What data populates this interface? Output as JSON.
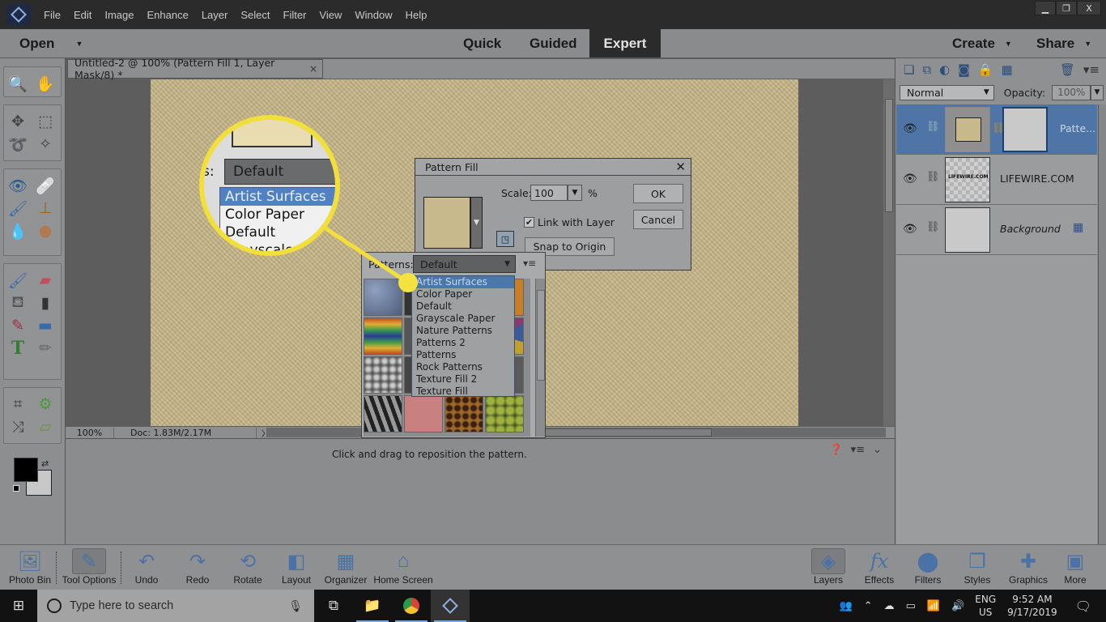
{
  "app": {
    "menu": [
      "File",
      "Edit",
      "Image",
      "Enhance",
      "Layer",
      "Select",
      "Filter",
      "View",
      "Window",
      "Help"
    ],
    "window_controls": {
      "minimize": "▁",
      "restore": "❐",
      "close": "X"
    }
  },
  "modebar": {
    "open_label": "Open",
    "modes": [
      {
        "label": "Quick",
        "active": false
      },
      {
        "label": "Guided",
        "active": false
      },
      {
        "label": "Expert",
        "active": true
      }
    ],
    "create_label": "Create",
    "share_label": "Share"
  },
  "document": {
    "tab_title": "Untitled-2 @ 100% (Pattern Fill 1, Layer Mask/8) *",
    "tab_close": "×",
    "zoom": "100%",
    "doc_size": "Doc: 1.83M/2.17M",
    "hint": "Click and drag to reposition the pattern."
  },
  "tools": [
    {
      "name": "zoom-tool",
      "glyph": "🔍"
    },
    {
      "name": "hand-tool",
      "glyph": "✋"
    },
    {
      "name": "move-tool",
      "glyph": "✥"
    },
    {
      "name": "marquee-tool",
      "glyph": "⬚"
    },
    {
      "name": "lasso-tool",
      "glyph": "➰"
    },
    {
      "name": "quick-selection-tool",
      "glyph": "✧"
    },
    {
      "name": "red-eye-tool",
      "glyph": "👁"
    },
    {
      "name": "spot-healing-tool",
      "glyph": "🩹"
    },
    {
      "name": "smart-brush-tool",
      "glyph": "🖌"
    },
    {
      "name": "clone-stamp-tool",
      "glyph": "⊥"
    },
    {
      "name": "blur-tool",
      "glyph": "💧"
    },
    {
      "name": "sponge-tool",
      "glyph": "●"
    },
    {
      "name": "brush-tool",
      "glyph": "🖌"
    },
    {
      "name": "eraser-tool",
      "glyph": "▰"
    },
    {
      "name": "paint-bucket-tool",
      "glyph": "⛾"
    },
    {
      "name": "gradient-tool",
      "glyph": "▮"
    },
    {
      "name": "eyedropper-tool",
      "glyph": "✎"
    },
    {
      "name": "shape-tool",
      "glyph": "▬"
    },
    {
      "name": "type-tool",
      "glyph": "T"
    },
    {
      "name": "pencil-tool",
      "glyph": "✏"
    },
    {
      "name": "crop-tool",
      "glyph": "⌗"
    },
    {
      "name": "recompose-tool",
      "glyph": "⚙"
    },
    {
      "name": "content-aware-move-tool",
      "glyph": "⤨"
    },
    {
      "name": "straighten-tool",
      "glyph": "⏥"
    }
  ],
  "colors": {
    "foreground": "#000000",
    "background": "#c8c8c8",
    "accent": "#4f74a6",
    "callout": "#f2df3a"
  },
  "layers_panel": {
    "blend_mode": "Normal",
    "opacity_label": "Opacity:",
    "opacity": "100%",
    "layers": [
      {
        "name": "Patte...",
        "selected": true,
        "italic": false
      },
      {
        "name": "LIFEWIRE.COM",
        "selected": false,
        "italic": false,
        "thumb_text": "LIFEWIRE.COM"
      },
      {
        "name": "Background",
        "selected": false,
        "italic": true
      }
    ]
  },
  "dialog": {
    "title": "Pattern Fill",
    "scale_label": "Scale:",
    "scale_value": "100",
    "scale_unit": "%",
    "link_label": "Link with Layer",
    "link_checked": true,
    "snap_label": "Snap to Origin",
    "ok_label": "OK",
    "cancel_label": "Cancel"
  },
  "picker": {
    "label": "Patterns:",
    "selected": "Default",
    "options": [
      "Artist Surfaces",
      "Color Paper",
      "Default",
      "Grayscale Paper",
      "Nature Patterns",
      "Patterns 2",
      "Patterns",
      "Rock Patterns",
      "Texture Fill 2",
      "Texture Fill"
    ],
    "highlighted": "Artist Surfaces"
  },
  "magnifier": {
    "label_fragment": "s:",
    "selected": "Default",
    "items": [
      "Artist Surfaces",
      "Color Paper",
      "Default",
      "Grayscale P..."
    ]
  },
  "bottombar": {
    "left": [
      {
        "label": "Photo Bin",
        "icon": "photo-bin-icon",
        "glyph": "🖼"
      },
      {
        "label": "Tool Options",
        "icon": "tool-options-icon",
        "glyph": "✎",
        "active": true
      },
      {
        "label": "Undo",
        "icon": "undo-icon",
        "glyph": "↶"
      },
      {
        "label": "Redo",
        "icon": "redo-icon",
        "glyph": "↷"
      },
      {
        "label": "Rotate",
        "icon": "rotate-icon",
        "glyph": "⟲"
      },
      {
        "label": "Layout",
        "icon": "layout-icon",
        "glyph": "◧"
      },
      {
        "label": "Organizer",
        "icon": "organizer-icon",
        "glyph": "▦"
      },
      {
        "label": "Home Screen",
        "icon": "home-icon",
        "glyph": "⌂"
      }
    ],
    "right": [
      {
        "label": "Layers",
        "icon": "layers-icon",
        "glyph": "◈",
        "active": true
      },
      {
        "label": "Effects",
        "icon": "effects-icon",
        "glyph": "fx"
      },
      {
        "label": "Filters",
        "icon": "filters-icon",
        "glyph": "⬤"
      },
      {
        "label": "Styles",
        "icon": "styles-icon",
        "glyph": "❐"
      },
      {
        "label": "Graphics",
        "icon": "graphics-icon",
        "glyph": "✚"
      },
      {
        "label": "More",
        "icon": "more-icon",
        "glyph": "▣"
      }
    ]
  },
  "taskbar": {
    "search_placeholder": "Type here to search",
    "lang_top": "ENG",
    "lang_bottom": "US",
    "time": "9:52 AM",
    "date": "9/17/2019"
  }
}
